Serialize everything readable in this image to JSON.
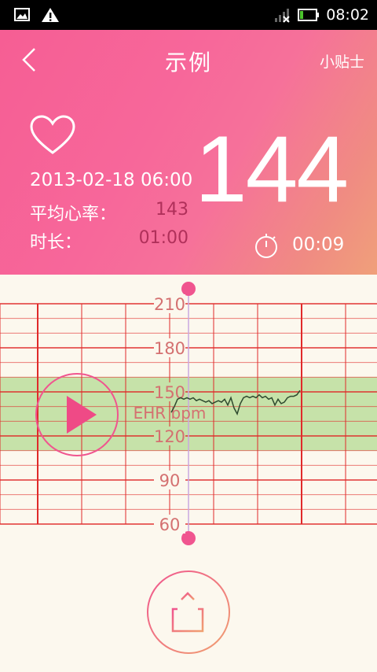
{
  "status_bar": {
    "time": "08:02",
    "icons": [
      "image-icon",
      "warning-icon",
      "signal-off-icon",
      "battery-icon"
    ]
  },
  "header": {
    "title": "示例",
    "tips_label": "小贴士",
    "date": "2013-02-18 06:00",
    "avg_label": "平均心率：",
    "avg_value": "143",
    "duration_label": "时长：",
    "duration_value": "01:00",
    "current_bpm": "144",
    "timer": "00:09"
  },
  "colors": {
    "accent": "#f65e94",
    "grid": "#e02a2a",
    "normal_band": "#c6e2a9",
    "background": "#fcf8ee"
  },
  "chart_data": {
    "type": "line",
    "ylabel": "EHR bpm",
    "y_ticks": [
      60,
      90,
      120,
      150,
      180,
      210
    ],
    "ylim": [
      60,
      210
    ],
    "normal_range": [
      110,
      160
    ],
    "series": [
      {
        "x": [
          0,
          2,
          4,
          6,
          8,
          10,
          12,
          14,
          16,
          18,
          20,
          22,
          24,
          26,
          28,
          30,
          32,
          34,
          36,
          38,
          40,
          42,
          44,
          46,
          48,
          50,
          52,
          54,
          56,
          58,
          60,
          62,
          64,
          66,
          68,
          70,
          72,
          74,
          76,
          78,
          80,
          82
        ],
        "values": [
          136,
          140,
          145,
          146,
          145,
          146,
          145,
          146,
          144,
          145,
          144,
          143,
          144,
          142,
          143,
          144,
          143,
          145,
          141,
          146,
          139,
          135,
          142,
          146,
          147,
          146,
          147,
          146,
          148,
          146,
          147,
          145,
          146,
          141,
          145,
          142,
          143,
          146,
          147,
          147,
          148,
          151
        ]
      }
    ]
  }
}
